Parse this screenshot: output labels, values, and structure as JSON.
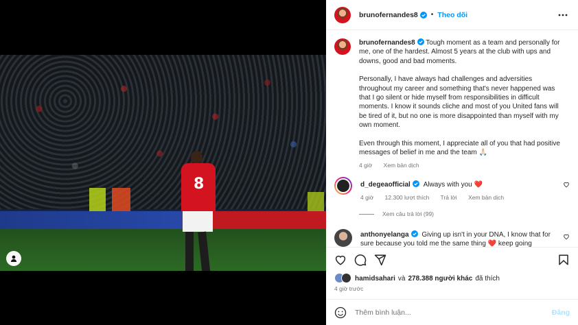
{
  "post": {
    "username": "brunofernandes8",
    "follow_label": "Theo dõi",
    "dot": "•"
  },
  "caption": {
    "username": "brunofernandes8",
    "text1": "Tough moment as a team and personally for me, one of the hardest. Almost 5 years at the club with ups and downs, good and bad moments.",
    "text2": "Personally, I have always had challenges and adversities throughout my career and something that's never happened was that I go silent or hide myself from responsibilities in difficult moments. I know it sounds cliche and most of you United fans will be tired of it, but no one is more disappointed than myself with my own moment.",
    "text3": "Even through this moment, I appreciate all of you that had positive messages of belief in me and the team 🙏🏻",
    "time": "4 giờ",
    "translate": "Xem bản dịch"
  },
  "comments": [
    {
      "username": "d_degeaofficial",
      "text": "Always with you",
      "emoji": "❤️",
      "time": "4 giờ",
      "likes": "12.300 lượt thích",
      "reply": "Trả lời",
      "translate": "Xem bản dịch",
      "view_replies": "Xem câu trả lời (99)"
    },
    {
      "username": "anthonyelanga",
      "text": "Giving up isn't in your DNA, I know that for sure because you told me the same thing",
      "emoji": "❤️",
      "tail": "keep going"
    }
  ],
  "likes": {
    "user": "hamidsahari",
    "conj": "và",
    "others": "278.388 người khác",
    "suffix": "đã thích"
  },
  "posted_time": "4 giờ trước",
  "comment_box": {
    "placeholder": "Thêm bình luận...",
    "post_label": "Đăng"
  },
  "icons": [
    "more-icon",
    "verified-icon",
    "heart-icon",
    "comment-icon",
    "share-icon",
    "bookmark-icon",
    "emoji-icon",
    "user-tag-icon"
  ],
  "colors": {
    "accent": "#0095f6",
    "heart": "#ed4956",
    "muted": "#737373"
  }
}
